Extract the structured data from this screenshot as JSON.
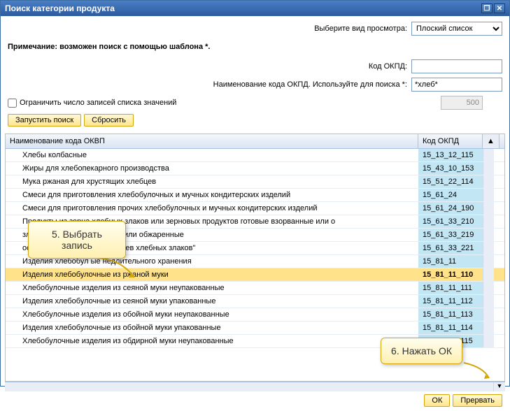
{
  "title": "Поиск категории продукта",
  "viewSelect": {
    "label": "Выберите вид просмотра:",
    "value": "Плоский список"
  },
  "note": "Примечание: возможен поиск с помощью шаблона *.",
  "form": {
    "codeLabel": "Код ОКПД:",
    "codeValue": "",
    "nameLabel": "Наименование кода ОКПД. Используйте для поиска *:",
    "nameValue": "*хлеб*"
  },
  "limit": {
    "label": "Ограничить число записей списка значений",
    "value": "500"
  },
  "buttons": {
    "search": "Запустить поиск",
    "reset": "Сбросить"
  },
  "columns": {
    "name": "Наименование кода ОКВП",
    "code": "Код ОКПД"
  },
  "rows": [
    {
      "name": "Хлебы колбасные",
      "code": "15_13_12_115"
    },
    {
      "name": "Жиры для хлебопекарного производства",
      "code": "15_43_10_153"
    },
    {
      "name": "Мука ржаная для хрустящих хлебцев",
      "code": "15_51_22_114"
    },
    {
      "name": "Смеси для приготовления хлебобулочных и мучных кондитерских изделий",
      "code": "15_61_24"
    },
    {
      "name": "Смеси для приготовления прочих хлебобулочных и мучных кондитерских изделий",
      "code": "15_61_24_190"
    },
    {
      "name": "Продукты из зерна хлебных злаков или зерновых продуктов готовые взорванные или о",
      "code": "15_61_33_210"
    },
    {
      "name": "злаков готовые взорванные или обжаренные",
      "code": "15_61_33_219"
    },
    {
      "name": "основе необжаренных хлопьев хлебных злаков\"",
      "code": "15_61_33_221"
    },
    {
      "name": "Изделия хлебобул ые недлительного хранения",
      "code": "15_81_11"
    },
    {
      "name": "Изделия хлебобулочные из ржаной муки",
      "code": "15_81_11_110",
      "selected": true
    },
    {
      "name": "Хлебобулочные изделия из сеяной муки неупакованные",
      "code": "15_81_11_111"
    },
    {
      "name": "Изделия хлебобулочные из сеяной муки упакованные",
      "code": "15_81_11_112"
    },
    {
      "name": "Хлебобулочные изделия из обойной муки неупакованные",
      "code": "15_81_11_113"
    },
    {
      "name": "Изделия хлебобулочные из обойной муки упакованные",
      "code": "15_81_11_114"
    },
    {
      "name": "Хлебобулочные изделия из обдирной муки неупакованные",
      "code": "15_81_11_115"
    }
  ],
  "dialogButtons": {
    "ok": "ОК",
    "cancel": "Прервать"
  },
  "callouts": {
    "c1": "5. Выбрать запись",
    "c2": "6. Нажать ОК"
  }
}
